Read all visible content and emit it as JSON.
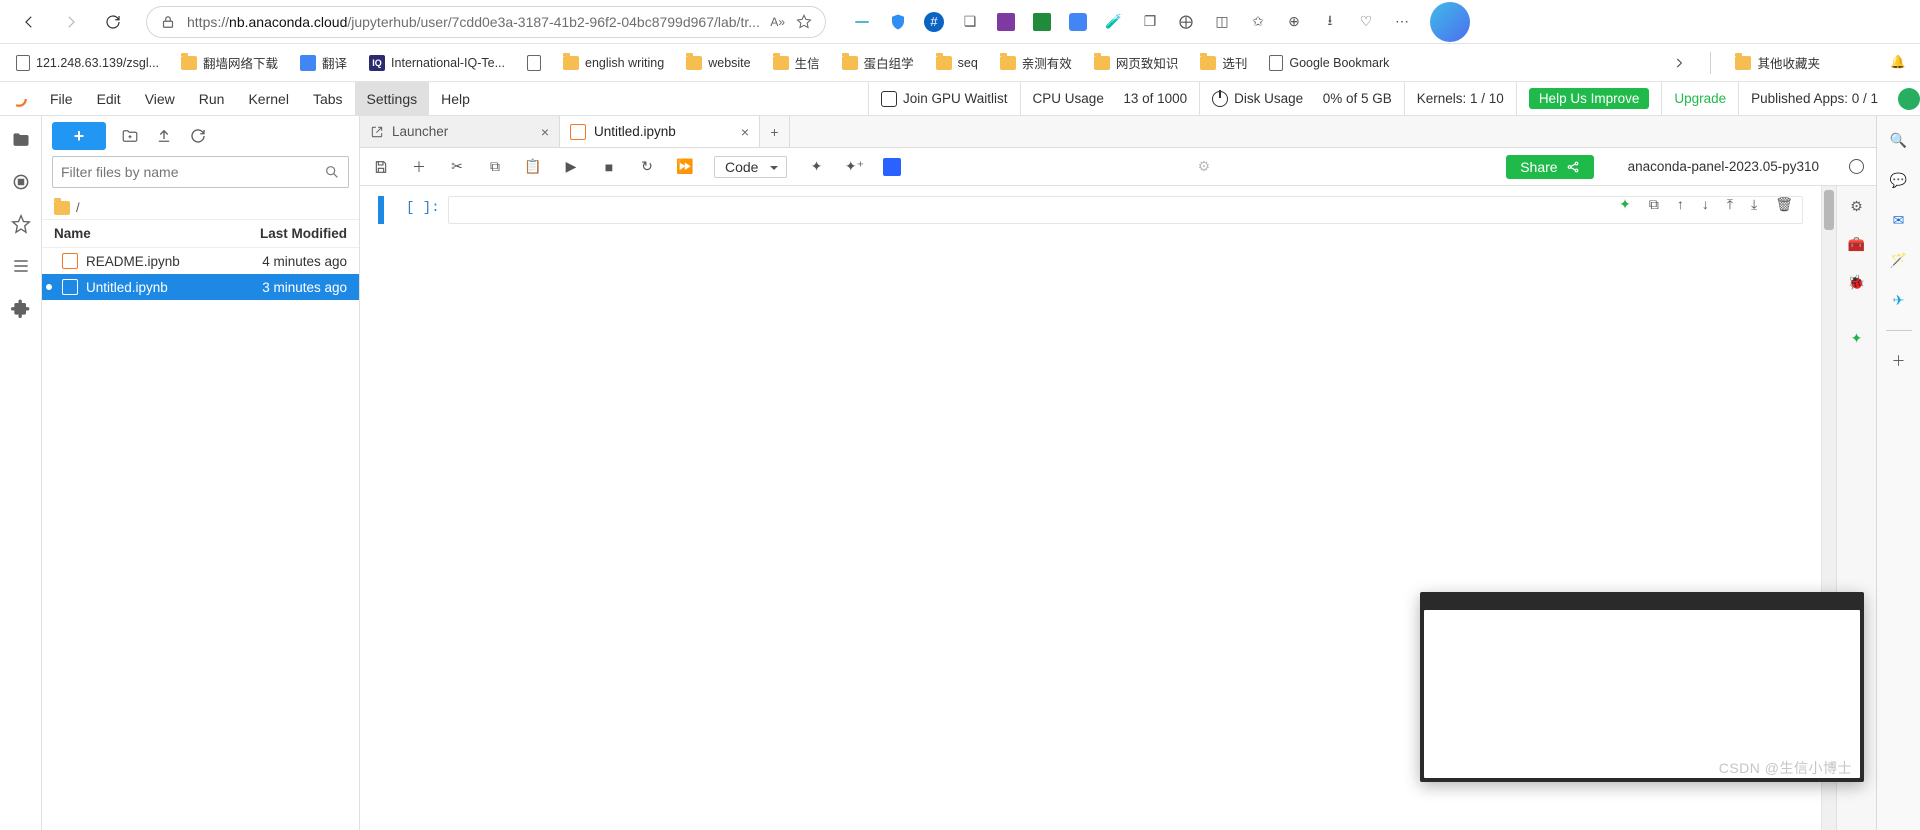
{
  "browser": {
    "url_host": "nb.anaconda.cloud",
    "url_path": "/jupyterhub/user/7cdd0e3a-3187-41b2-96f2-04bc8799d967/lab/tr...",
    "reader_badge": "A»"
  },
  "bookmarks": [
    {
      "icon": "page",
      "label": "121.248.63.139/zsgl..."
    },
    {
      "icon": "folder",
      "label": "翻墙网络下载"
    },
    {
      "icon": "trans",
      "label": "翻译"
    },
    {
      "icon": "iq",
      "label": "International-IQ-Te..."
    },
    {
      "icon": "page",
      "label": ""
    },
    {
      "icon": "folder",
      "label": "english writing"
    },
    {
      "icon": "folder",
      "label": "website"
    },
    {
      "icon": "folder",
      "label": "生信"
    },
    {
      "icon": "folder",
      "label": "蛋白组学"
    },
    {
      "icon": "folder",
      "label": "seq"
    },
    {
      "icon": "folder",
      "label": "亲测有效"
    },
    {
      "icon": "folder",
      "label": "网页致知识"
    },
    {
      "icon": "folder",
      "label": "选刊"
    },
    {
      "icon": "page",
      "label": "Google Bookmark"
    }
  ],
  "bookmarks_overflow": "其他收藏夹",
  "menubar": [
    "File",
    "Edit",
    "View",
    "Run",
    "Kernel",
    "Tabs",
    "Settings",
    "Help"
  ],
  "menubar_active": 6,
  "statusbar": {
    "gpu": "Join GPU Waitlist",
    "cpu_label": "CPU Usage",
    "cpu_value": "13 of 1000",
    "disk_label": "Disk Usage",
    "disk_value": "0% of 5 GB",
    "kernels": "Kernels: 1 / 10",
    "help": "Help Us Improve",
    "upgrade": "Upgrade",
    "apps": "Published Apps: 0 / 1"
  },
  "filebrowser": {
    "filter_placeholder": "Filter files by name",
    "breadcrumb": "/",
    "columns": {
      "name": "Name",
      "modified": "Last Modified"
    },
    "files": [
      {
        "name": "README.ipynb",
        "modified": "4 minutes ago",
        "selected": false
      },
      {
        "name": "Untitled.ipynb",
        "modified": "3 minutes ago",
        "selected": true
      }
    ]
  },
  "tabs": [
    {
      "icon": "launch",
      "label": "Launcher",
      "active": false
    },
    {
      "icon": "nb",
      "label": "Untitled.ipynb",
      "active": true
    }
  ],
  "notebook": {
    "celltype": "Code",
    "share": "Share",
    "kernel": "anaconda-panel-2023.05-py310",
    "prompt": "[ ]:"
  },
  "watermark": "CSDN @生信小博士"
}
